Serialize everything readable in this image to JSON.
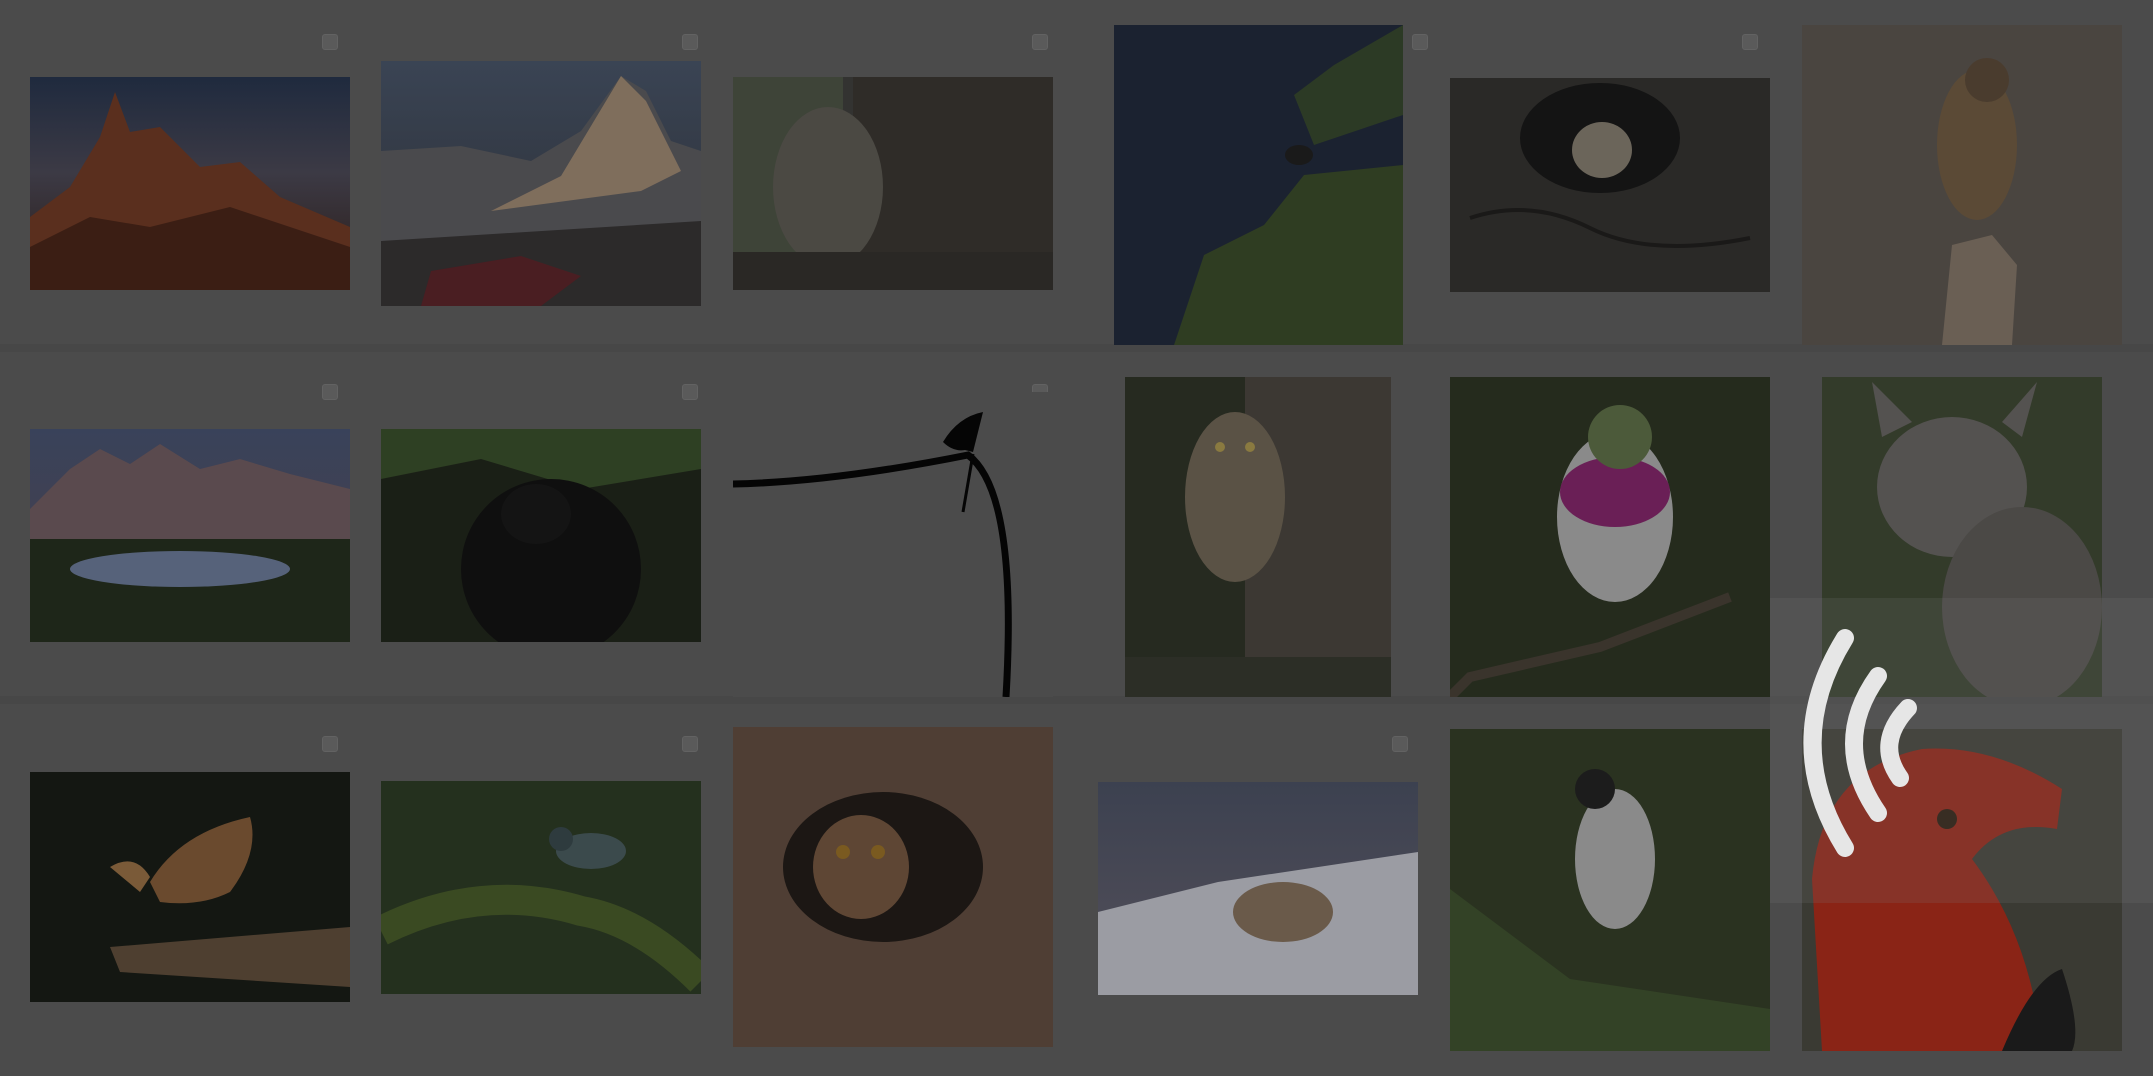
{
  "gallery": {
    "items": [
      {
        "subject": "mountain-sunset"
      },
      {
        "subject": "rocky-peak"
      },
      {
        "subject": "owl-on-trunk"
      },
      {
        "subject": "bird-on-conifer"
      },
      {
        "subject": "owl-in-tree-hole"
      },
      {
        "subject": "falcon-on-stump"
      },
      {
        "subject": "mountain-lake"
      },
      {
        "subject": "black-bear"
      },
      {
        "subject": "bird-silhouette-on-branch"
      },
      {
        "subject": "screech-owl"
      },
      {
        "subject": "hummingbird"
      },
      {
        "subject": "lynx"
      },
      {
        "subject": "bird-spreading-wings"
      },
      {
        "subject": "bird-on-mossy-branch"
      },
      {
        "subject": "owl-in-bark-cavity"
      },
      {
        "subject": "animal-in-snow"
      },
      {
        "subject": "warbler-on-pine"
      },
      {
        "subject": "red-bird"
      }
    ]
  },
  "cast": {
    "icon": "cast-signal-icon"
  },
  "colors": {
    "backdrop": "#474747",
    "cell": "#4b4b4b",
    "icon": "#e6e6e6"
  }
}
